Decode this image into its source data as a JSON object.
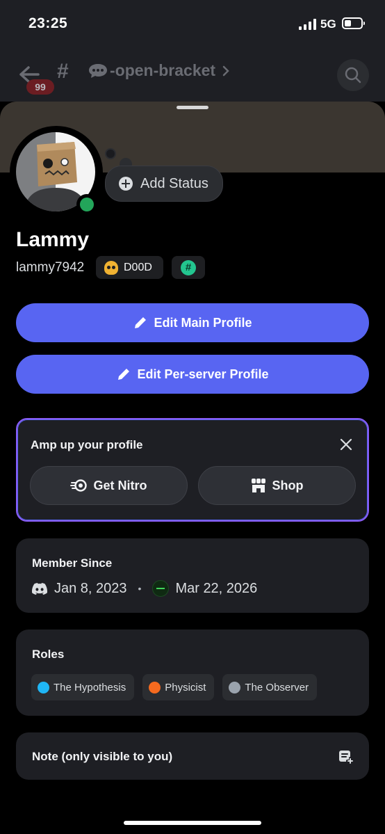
{
  "status_bar": {
    "time": "23:25",
    "network": "5G"
  },
  "header": {
    "unread_badge": "99",
    "channel_name": "-open-bracket"
  },
  "profile": {
    "add_status_label": "Add Status",
    "display_name": "Lammy",
    "username": "lammy7942",
    "tag_label": "D00D",
    "hash_symbol": "#",
    "status_color": "#23a55a"
  },
  "buttons": {
    "edit_main": "Edit Main Profile",
    "edit_server": "Edit Per-server Profile"
  },
  "amp": {
    "title": "Amp up your profile",
    "nitro_label": "Get Nitro",
    "shop_label": "Shop"
  },
  "member_since": {
    "title": "Member Since",
    "discord_date": "Jan 8, 2023",
    "separator": "•",
    "server_date": "Mar 22, 2026"
  },
  "roles": {
    "title": "Roles",
    "items": [
      {
        "label": "The Hypothesis",
        "color": "#1fb6f5"
      },
      {
        "label": "Physicist",
        "color": "#f56a1f"
      },
      {
        "label": "The Observer",
        "color": "#9aa3ad"
      }
    ]
  },
  "note": {
    "title": "Note (only visible to you)"
  },
  "colors": {
    "accent": "#5865f2",
    "amp_border": "#8a5cf5"
  }
}
